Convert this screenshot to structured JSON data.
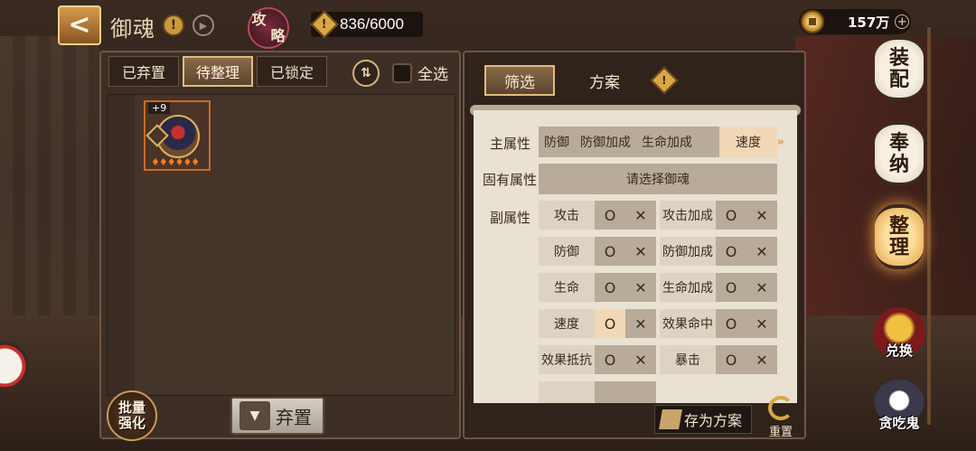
{
  "header": {
    "back_glyph": "<",
    "title": "御魂",
    "info_glyph": "!",
    "play_glyph": "▶",
    "guide_chars": [
      "攻",
      "略"
    ],
    "capacity_icon": "!",
    "capacity": "836/6000",
    "coins": "157万",
    "coins_plus": "+"
  },
  "left_panel": {
    "tabs": [
      {
        "label": "已弃置"
      },
      {
        "label": "待整理"
      },
      {
        "label": "已锁定"
      }
    ],
    "active_tab": "待整理",
    "sort_glyph": "⇅",
    "select_all_label": "全选",
    "items": [
      {
        "level": "+9",
        "stars": "♦♦♦♦♦♦"
      }
    ],
    "batch_label_line1": "批量",
    "batch_label_line2": "强化",
    "discard_label": "弃置"
  },
  "right_panel": {
    "tabs": [
      {
        "label": "筛选"
      },
      {
        "label": "方案"
      }
    ],
    "active_tab": "筛选",
    "info_glyph": "!",
    "main_attr_label": "主属性",
    "main_attr_options": [
      "防御",
      "防御加成",
      "生命加成",
      "速度"
    ],
    "main_attr_selected": "速度",
    "main_attr_more": "»",
    "fixed_attr_label": "固有属性",
    "fixed_attr_placeholder": "请选择御魂",
    "sub_attr_label": "副属性",
    "sub_attrs": [
      {
        "name": "攻击",
        "o": "O",
        "x": "✕",
        "selected": false
      },
      {
        "name": "攻击加成",
        "o": "O",
        "x": "✕",
        "selected": false
      },
      {
        "name": "防御",
        "o": "O",
        "x": "✕",
        "selected": false
      },
      {
        "name": "防御加成",
        "o": "O",
        "x": "✕",
        "selected": false
      },
      {
        "name": "生命",
        "o": "O",
        "x": "✕",
        "selected": false
      },
      {
        "name": "生命加成",
        "o": "O",
        "x": "✕",
        "selected": false
      },
      {
        "name": "速度",
        "o": "O",
        "x": "✕",
        "selected": true
      },
      {
        "name": "效果命中",
        "o": "O",
        "x": "✕",
        "selected": false
      },
      {
        "name": "效果抵抗",
        "o": "O",
        "x": "✕",
        "selected": false
      },
      {
        "name": "暴击",
        "o": "O",
        "x": "✕",
        "selected": false
      }
    ],
    "save_plan_label": "存为方案",
    "reset_label": "重置"
  },
  "side_menu": {
    "lanterns": [
      {
        "line1": "装",
        "line2": "配"
      },
      {
        "line1": "奉",
        "line2": "纳"
      },
      {
        "line1": "整",
        "line2": "理"
      }
    ],
    "active": "整理",
    "exchange_label": "兑换",
    "glutton_label": "贪吃鬼"
  }
}
